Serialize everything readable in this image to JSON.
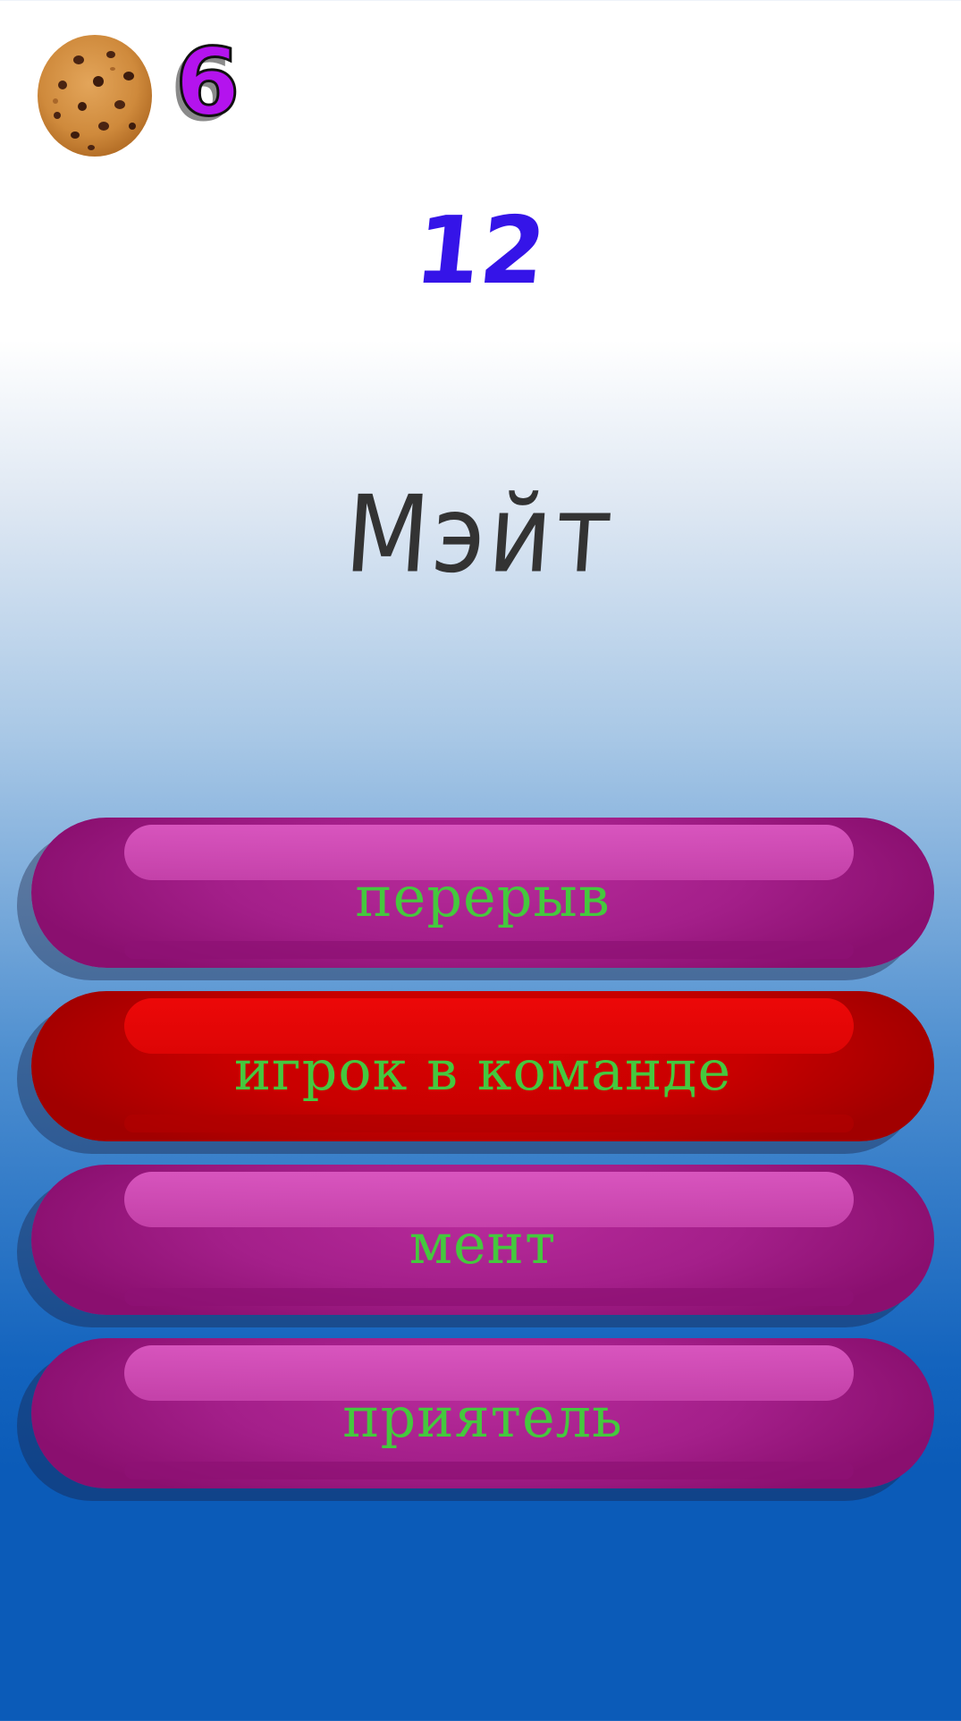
{
  "hud": {
    "cookie_icon": "cookie-icon",
    "cookie_count": "6"
  },
  "timer": "12",
  "word": "Мэйт",
  "answers": [
    {
      "label": "перерыв",
      "state": "default",
      "color": "#a41f8a"
    },
    {
      "label": "игрок в команде",
      "state": "highlighted",
      "color": "#c80000"
    },
    {
      "label": "мент",
      "state": "default",
      "color": "#a41f8a"
    },
    {
      "label": "приятель",
      "state": "default",
      "color": "#a41f8a"
    }
  ],
  "colors": {
    "cookie_count": "#b413ee",
    "timer": "#3514e8",
    "word": "#333333",
    "answer_text": "#45c83e",
    "answer_button": "#a41f8a",
    "answer_button_highlight": "#c80000"
  }
}
